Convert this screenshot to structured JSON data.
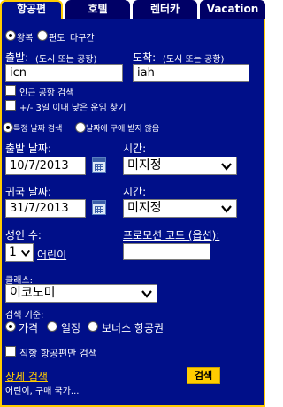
{
  "tabs": [
    {
      "label": "항공편",
      "active": true
    },
    {
      "label": "호텔",
      "active": false
    },
    {
      "label": "렌터카",
      "active": false
    },
    {
      "label": "Vacation",
      "active": false
    }
  ],
  "trip_type": {
    "round_trip": "왕복",
    "one_way": "편도",
    "multi_city": "다구간",
    "selected": "round_trip"
  },
  "origin": {
    "label": "출발:",
    "hint": "(도시 또는 공항)",
    "value": "icn",
    "nearby_label": "인근 공항 검색"
  },
  "destination": {
    "label": "도착:",
    "hint": "(도시 또는 공항)",
    "value": "iah"
  },
  "flex_dates_label": "+/- 3일 이내 낮은 운임 찾기",
  "date_mode": {
    "specific": "특정 날짜 검색",
    "any": "날짜에 구애 받지 않음",
    "selected": "specific"
  },
  "depart": {
    "label": "출발 날짜:",
    "value": "10/7/2013",
    "time_label": "시간:",
    "time_value": "미지정"
  },
  "return": {
    "label": "귀국 날짜:",
    "value": "31/7/2013",
    "time_label": "시간:",
    "time_value": "미지정"
  },
  "passengers": {
    "adults_label": "성인 수:",
    "adults_value": "1",
    "children_link": "어린이"
  },
  "promo": {
    "label": "프로모션 코드 (옵션):",
    "value": ""
  },
  "cabin": {
    "label": "클래스:",
    "value": "이코노미"
  },
  "search_by": {
    "label": "검색 기준:",
    "price": "가격",
    "schedule": "일정",
    "award": "보너스 항공권",
    "selected": "price"
  },
  "nonstop_label": "직항 항공편만 검색",
  "advanced": {
    "link": "상세 검색",
    "sub": "어린이, 구매 국가..."
  },
  "search_button": "검색"
}
